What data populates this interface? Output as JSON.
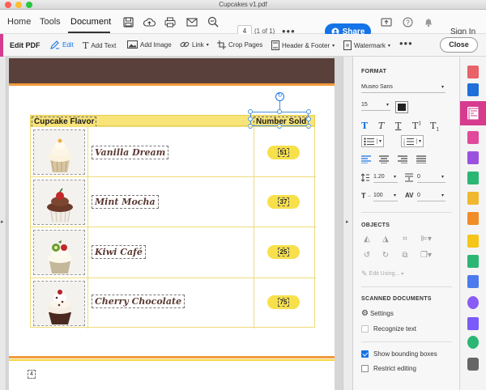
{
  "window": {
    "title": "Cupcakes v1.pdf"
  },
  "top_nav": {
    "tabs": [
      "Home",
      "Tools",
      "Document"
    ],
    "active_tab": "Document",
    "page_current": "4",
    "page_of": "(1 of 1)",
    "share_label": "Share",
    "sign_in_label": "Sign In"
  },
  "edit_toolbar": {
    "title": "Edit PDF",
    "tools": [
      "Edit",
      "Add Text",
      "Add Image",
      "Link",
      "Crop Pages",
      "Header & Footer",
      "Watermark"
    ],
    "close_label": "Close"
  },
  "document": {
    "page_number": "4",
    "table": {
      "headers": [
        "Cupcake Flavor",
        "Number Sold"
      ],
      "rows": [
        {
          "flavor": "Vanilla Dream",
          "sold": "51"
        },
        {
          "flavor": "Mint Mocha",
          "sold": "37"
        },
        {
          "flavor": "Kiwi Café",
          "sold": "25"
        },
        {
          "flavor": "Cherry Chocolate",
          "sold": "75"
        }
      ]
    }
  },
  "format_panel": {
    "heading": "FORMAT",
    "font": "Museo Sans",
    "size": "15",
    "text_color": "#222222",
    "line_spacing": "1.20",
    "paragraph_spacing": "0",
    "char_scale": "100",
    "char_spacing": "0",
    "objects_heading": "OBJECTS",
    "edit_using_label": "Edit Using...",
    "scanned_heading": "SCANNED DOCUMENTS",
    "settings_label": "Settings",
    "recognize_label": "Recognize text",
    "show_bounding_label": "Show bounding boxes",
    "show_bounding_checked": true,
    "restrict_editing_label": "Restrict editing",
    "restrict_editing_checked": false
  },
  "colors": {
    "accent_blue": "#1473e6",
    "edit_pink": "#d63b8e",
    "banner_brown": "#5a403a",
    "header_yellow": "#f9e47a",
    "pill_yellow": "#f7e04a"
  }
}
